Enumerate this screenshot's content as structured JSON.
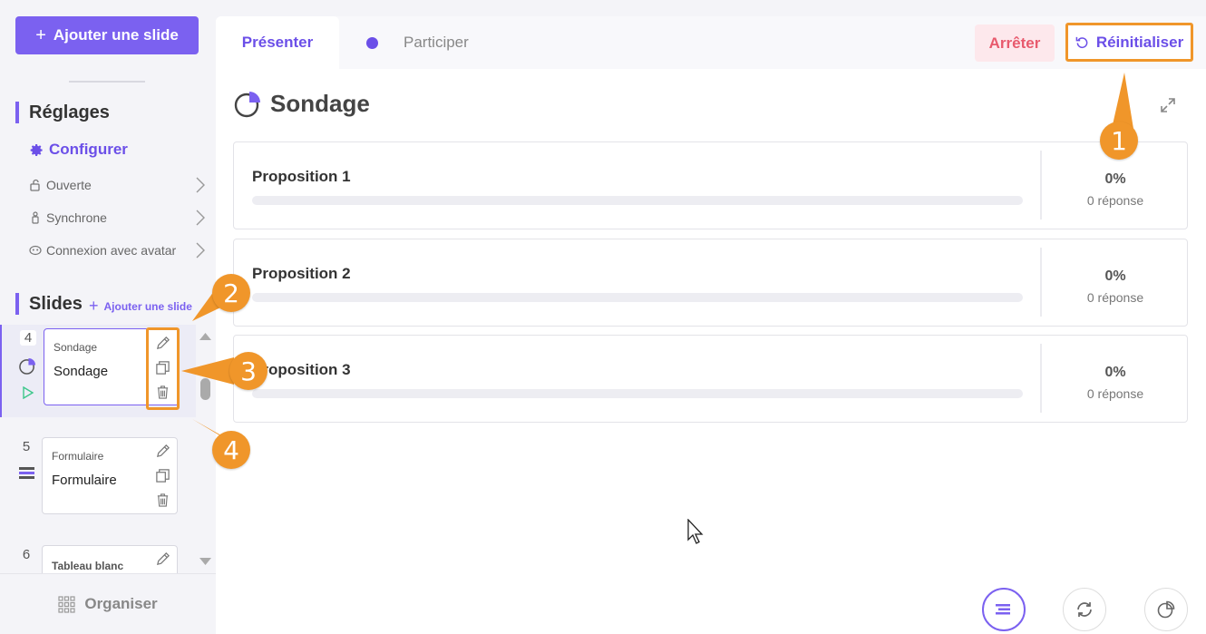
{
  "sidebar": {
    "add_slide_label": "Ajouter une slide",
    "settings_title": "Réglages",
    "configure_label": "Configurer",
    "menu": [
      {
        "label": "Ouverte"
      },
      {
        "label": "Synchrone"
      },
      {
        "label": "Connexion avec avatar"
      }
    ],
    "slides_title": "Slides",
    "slides_add_label": "Ajouter une slide",
    "slides": [
      {
        "number": "4",
        "kind": "Sondage",
        "name": "Sondage"
      },
      {
        "number": "5",
        "kind": "Formulaire",
        "name": "Formulaire"
      },
      {
        "number": "6",
        "kind": "Tableau blanc",
        "name": ""
      }
    ],
    "organize_label": "Organiser"
  },
  "tabs": {
    "present": "Présenter",
    "participate": "Participer"
  },
  "actions": {
    "stop": "Arrêter",
    "reset": "Réinitialiser"
  },
  "poll": {
    "title": "Sondage",
    "options": [
      {
        "label": "Proposition 1",
        "percent": "0%",
        "responses": "0 réponse",
        "fill": 0
      },
      {
        "label": "Proposition 2",
        "percent": "0%",
        "responses": "0 réponse",
        "fill": 0
      },
      {
        "label": "Proposition 3",
        "percent": "0%",
        "responses": "0 réponse",
        "fill": 0
      }
    ]
  },
  "callouts": [
    "1",
    "2",
    "3",
    "4"
  ],
  "colors": {
    "accent": "#7b61f0",
    "callout": "#f0962a",
    "stop": "#e85a6d"
  }
}
